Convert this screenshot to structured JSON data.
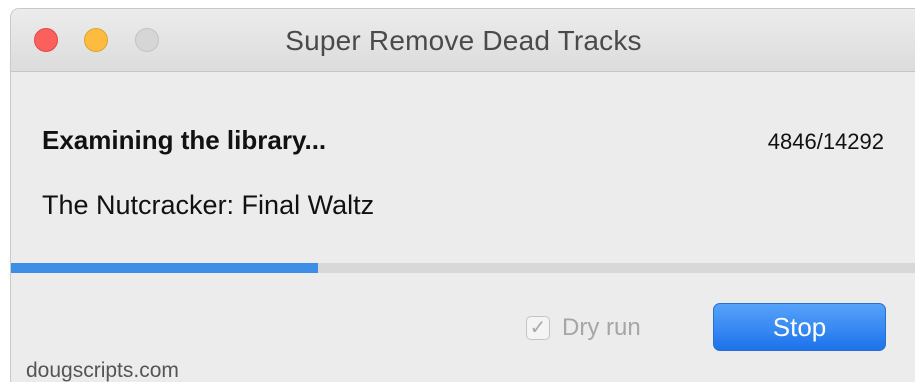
{
  "window": {
    "title": "Super Remove Dead Tracks"
  },
  "status": {
    "heading": "Examining the library...",
    "counter": "4846/14292",
    "current_track": "The Nutcracker: Final Waltz",
    "progress": 0.339
  },
  "controls": {
    "dry_run_label": "Dry run",
    "dry_run_checked": true,
    "dry_run_check_glyph": "✓",
    "stop_label": "Stop"
  },
  "footer": {
    "credit": "dougscripts.com"
  },
  "colors": {
    "accent": "#3e8ee8",
    "close": "#fc605c",
    "minimize": "#fdbc40",
    "zoom_disabled": "#d6d6d6"
  }
}
